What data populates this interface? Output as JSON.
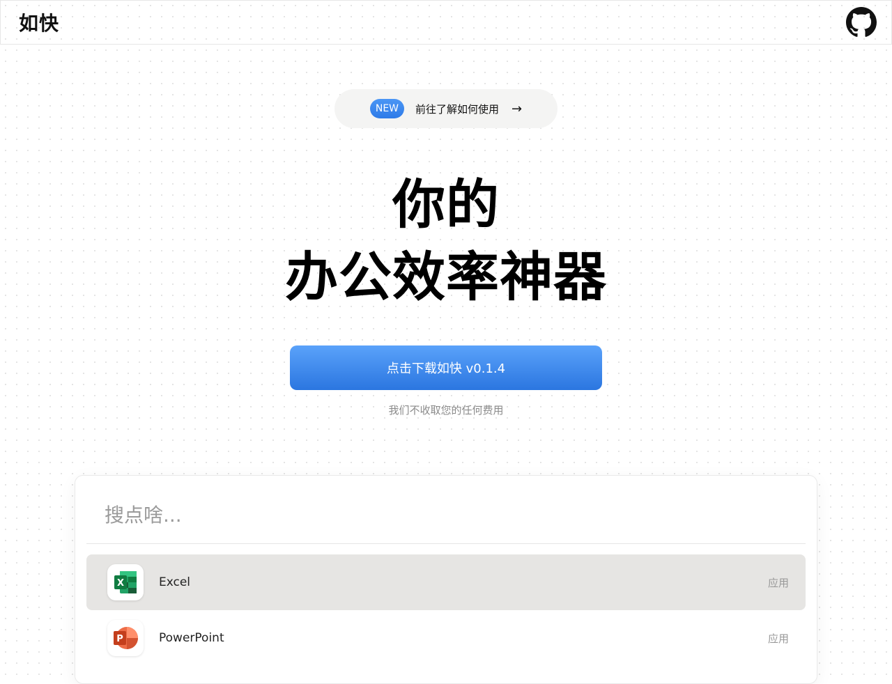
{
  "nav": {
    "brand": "如快",
    "github_icon": "github-icon"
  },
  "announcement": {
    "badge": "NEW",
    "text": "前往了解如何使用",
    "arrow": "→"
  },
  "hero": {
    "line1": "你的",
    "line2": "办公效率神器"
  },
  "download": {
    "label": "点击下载如快 v0.1.4",
    "note": "我们不收取您的任何费用"
  },
  "search": {
    "placeholder": "搜点啥...",
    "results": [
      {
        "name": "Excel",
        "type": "应用",
        "icon": "excel-icon",
        "selected": true
      },
      {
        "name": "PowerPoint",
        "type": "应用",
        "icon": "powerpoint-icon",
        "selected": false
      }
    ]
  },
  "colors": {
    "accent_blue": "#2b76e0",
    "excel_green": "#1f7a45",
    "powerpoint_orange": "#d2492b"
  }
}
